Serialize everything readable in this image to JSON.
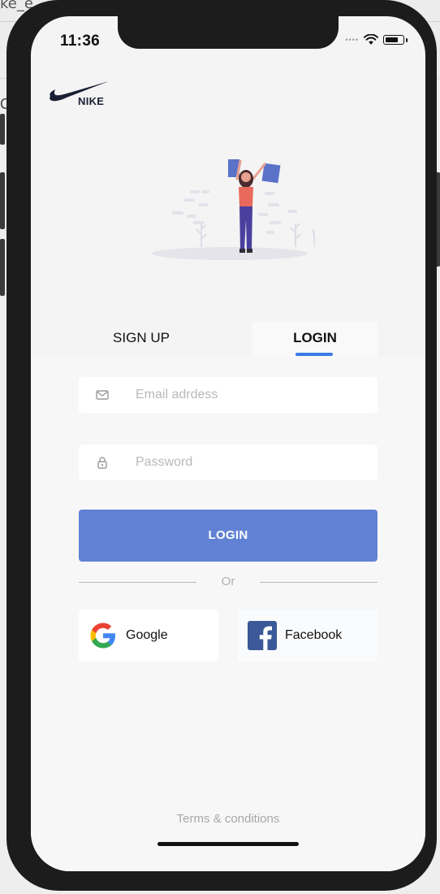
{
  "background_window": {
    "title_fragment": "ke_e",
    "left_fragment": "C"
  },
  "status_bar": {
    "time": "11:36",
    "signal_dots": "••••",
    "wifi_icon": "wifi-icon",
    "battery_icon": "battery-icon"
  },
  "brand": {
    "logo_text": "NIKE",
    "logo_icon": "swoosh-icon"
  },
  "illustration": {
    "description_icon": "shopping-woman-illustration"
  },
  "tabs": {
    "signup_label": "SIGN UP",
    "login_label": "LOGIN",
    "active": "LOGIN",
    "accent_color": "#3b7be6"
  },
  "form": {
    "email_placeholder": "Email adrdess",
    "email_icon": "mail-icon",
    "password_placeholder": "Password",
    "password_icon": "lock-icon",
    "submit_label": "LOGIN",
    "submit_color": "#6182d4"
  },
  "divider": {
    "label": "Or"
  },
  "social": {
    "google_label": "Google",
    "google_icon": "google-icon",
    "facebook_label": "Facebook",
    "facebook_icon": "facebook-icon",
    "facebook_color": "#3b5998"
  },
  "footer": {
    "terms_label": "Terms & conditions"
  }
}
